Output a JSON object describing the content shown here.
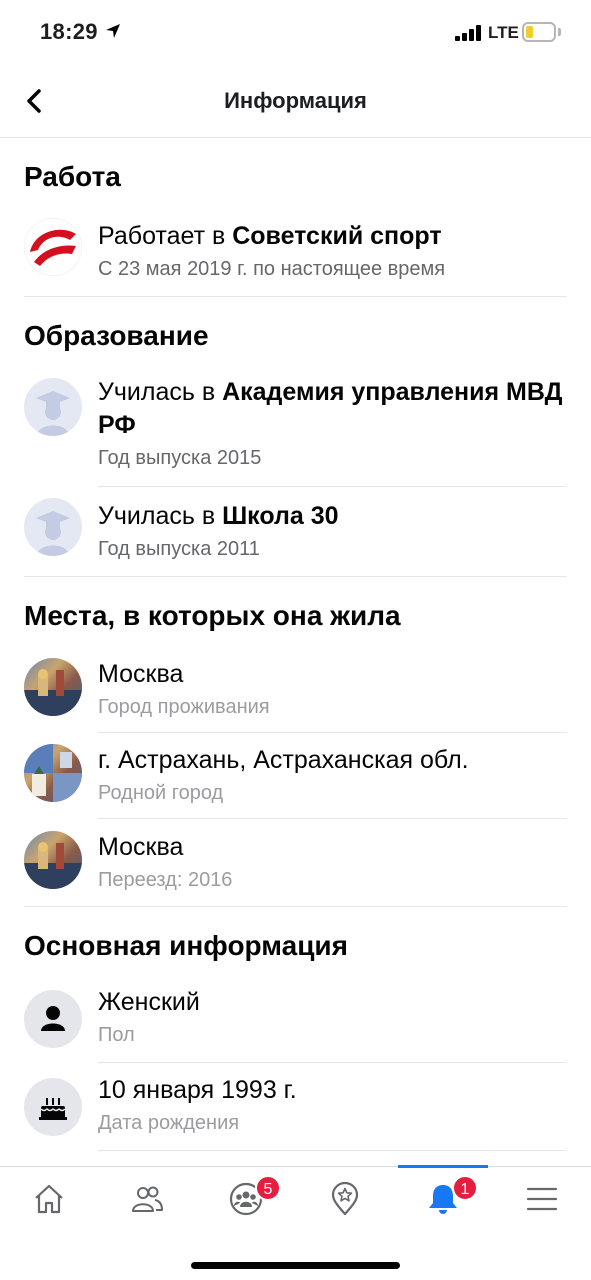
{
  "status_bar": {
    "time": "18:29",
    "network": "LTE",
    "battery_level": 0.25
  },
  "header": {
    "title": "Информация"
  },
  "sections": {
    "work": {
      "title": "Работа",
      "items": [
        {
          "prefix": "Работает в ",
          "name": "Советский спорт",
          "detail": "С  23 мая 2019 г. по настоящее время",
          "icon": "company-logo-icon"
        }
      ]
    },
    "education": {
      "title": "Образование",
      "items": [
        {
          "prefix": "Училась в ",
          "name": "Академия управления МВД РФ",
          "detail": "Год выпуска 2015",
          "icon": "graduation-cap-icon"
        },
        {
          "prefix": "Училась в ",
          "name": "Школа 30",
          "detail": "Год выпуска 2011",
          "icon": "graduation-cap-icon"
        }
      ]
    },
    "places": {
      "title": "Места, в которых она жила",
      "items": [
        {
          "name": "Москва",
          "detail": "Город проживания",
          "icon": "city-photo-icon"
        },
        {
          "name": "г. Астрахань, Астраханская обл.",
          "detail": "Родной город",
          "icon": "city-photo-icon"
        },
        {
          "name": "Москва",
          "detail": "Переезд: 2016",
          "icon": "city-photo-icon"
        }
      ]
    },
    "basic": {
      "title": "Основная информация",
      "items": [
        {
          "name": "Женский",
          "detail": "Пол",
          "icon": "person-icon"
        },
        {
          "name": "10 января 1993 г.",
          "detail": "Дата рождения",
          "icon": "birthday-cake-icon"
        }
      ]
    }
  },
  "tab_bar": {
    "tabs": [
      {
        "name": "home",
        "icon": "home-icon",
        "badge": ""
      },
      {
        "name": "friends",
        "icon": "friends-icon",
        "badge": ""
      },
      {
        "name": "groups",
        "icon": "groups-icon",
        "badge": "5"
      },
      {
        "name": "places",
        "icon": "location-star-icon",
        "badge": ""
      },
      {
        "name": "notifications",
        "icon": "bell-icon",
        "badge": "1",
        "active": true
      },
      {
        "name": "menu",
        "icon": "menu-icon",
        "badge": ""
      }
    ],
    "active_color": "#1877f2",
    "badge_color": "#e41e3f"
  }
}
